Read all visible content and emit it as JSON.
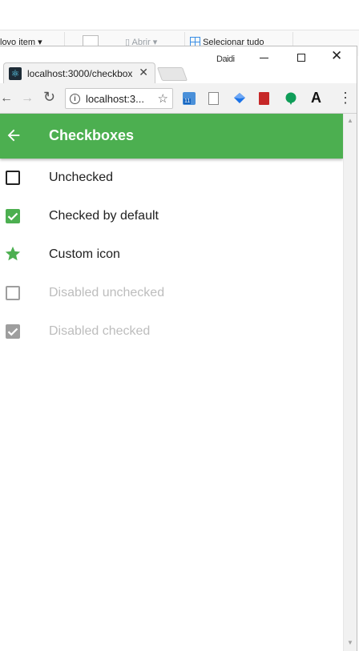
{
  "ribbon": {
    "new_item_label": "lovo item",
    "open_label": "Abrir",
    "select_all_label": "Selecionar tudo"
  },
  "browser": {
    "tab_title": "localhost:3000/checkbox",
    "tab_close": "✕",
    "user_label": "Daidi",
    "url": "localhost:3...",
    "back_glyph": "←",
    "forward_glyph": "→",
    "reload_glyph": "↻",
    "menu_glyph": "⋮",
    "ext_badge": "11",
    "ext_letter": "A"
  },
  "app": {
    "title": "Checkboxes",
    "accent_color": "#4caf50",
    "items": [
      {
        "label": "Unchecked",
        "state": "unchecked",
        "disabled": false
      },
      {
        "label": "Checked by default",
        "state": "checked",
        "disabled": false
      },
      {
        "label": "Custom icon",
        "state": "custom-star",
        "disabled": false
      },
      {
        "label": "Disabled unchecked",
        "state": "unchecked",
        "disabled": true
      },
      {
        "label": "Disabled checked",
        "state": "checked",
        "disabled": true
      }
    ]
  }
}
